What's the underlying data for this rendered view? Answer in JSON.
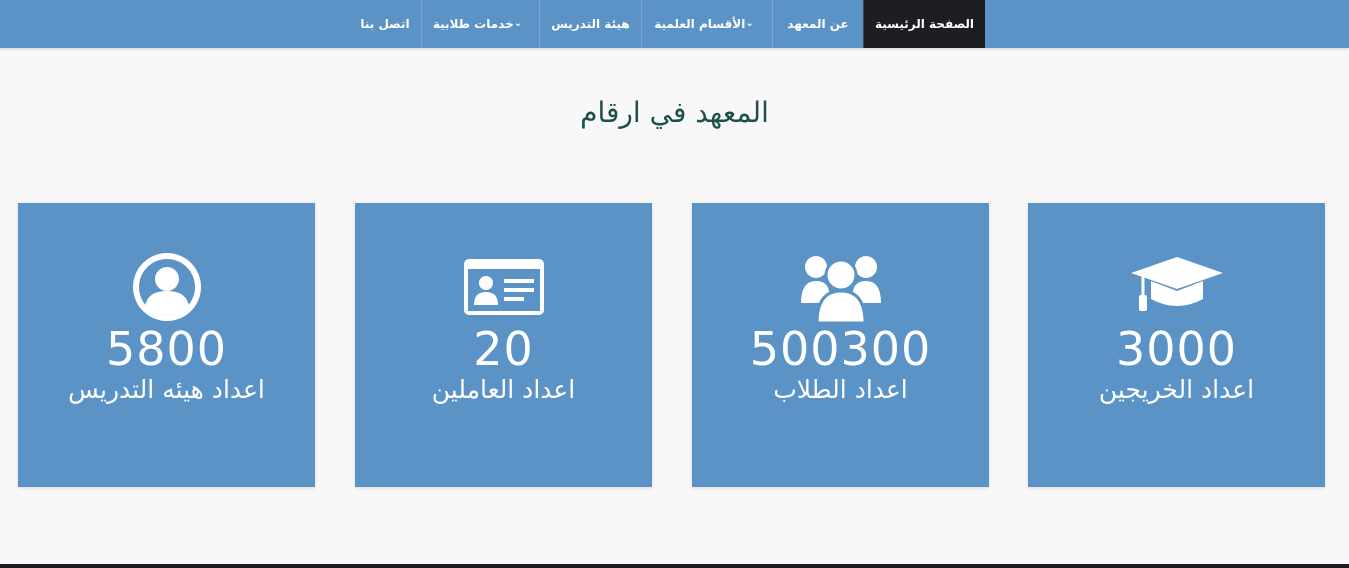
{
  "nav": {
    "items": [
      {
        "label": "الصفحة الرئيسية",
        "active": true,
        "dropdown": false
      },
      {
        "label": "عن المعهد",
        "active": false,
        "dropdown": false
      },
      {
        "label": "الأقسام العلمية",
        "active": false,
        "dropdown": true
      },
      {
        "label": "هيئة التدريس",
        "active": false,
        "dropdown": false
      },
      {
        "label": "خدمات طلابية",
        "active": false,
        "dropdown": true
      },
      {
        "label": "اتصل بنا",
        "active": false,
        "dropdown": false
      }
    ],
    "dropdown_icon": "chevron-down-icon"
  },
  "main": {
    "title": "المعهد في ارقام",
    "stats": [
      {
        "icon": "graduation-cap-icon",
        "value": "3000",
        "label": "اعداد الخريجين"
      },
      {
        "icon": "users-group-icon",
        "value": "500300",
        "label": "اعداد الطلاب"
      },
      {
        "icon": "id-card-icon",
        "value": "20",
        "label": "اعداد العاملين"
      },
      {
        "icon": "user-circle-icon",
        "value": "5800",
        "label": "اعداد هيئه التدريس"
      }
    ]
  },
  "colors": {
    "navbar": "#5b93c6",
    "active_nav": "#1c1e22",
    "card": "#5b93c6",
    "title": "#1d4f4b",
    "background": "#f8f8f8"
  }
}
